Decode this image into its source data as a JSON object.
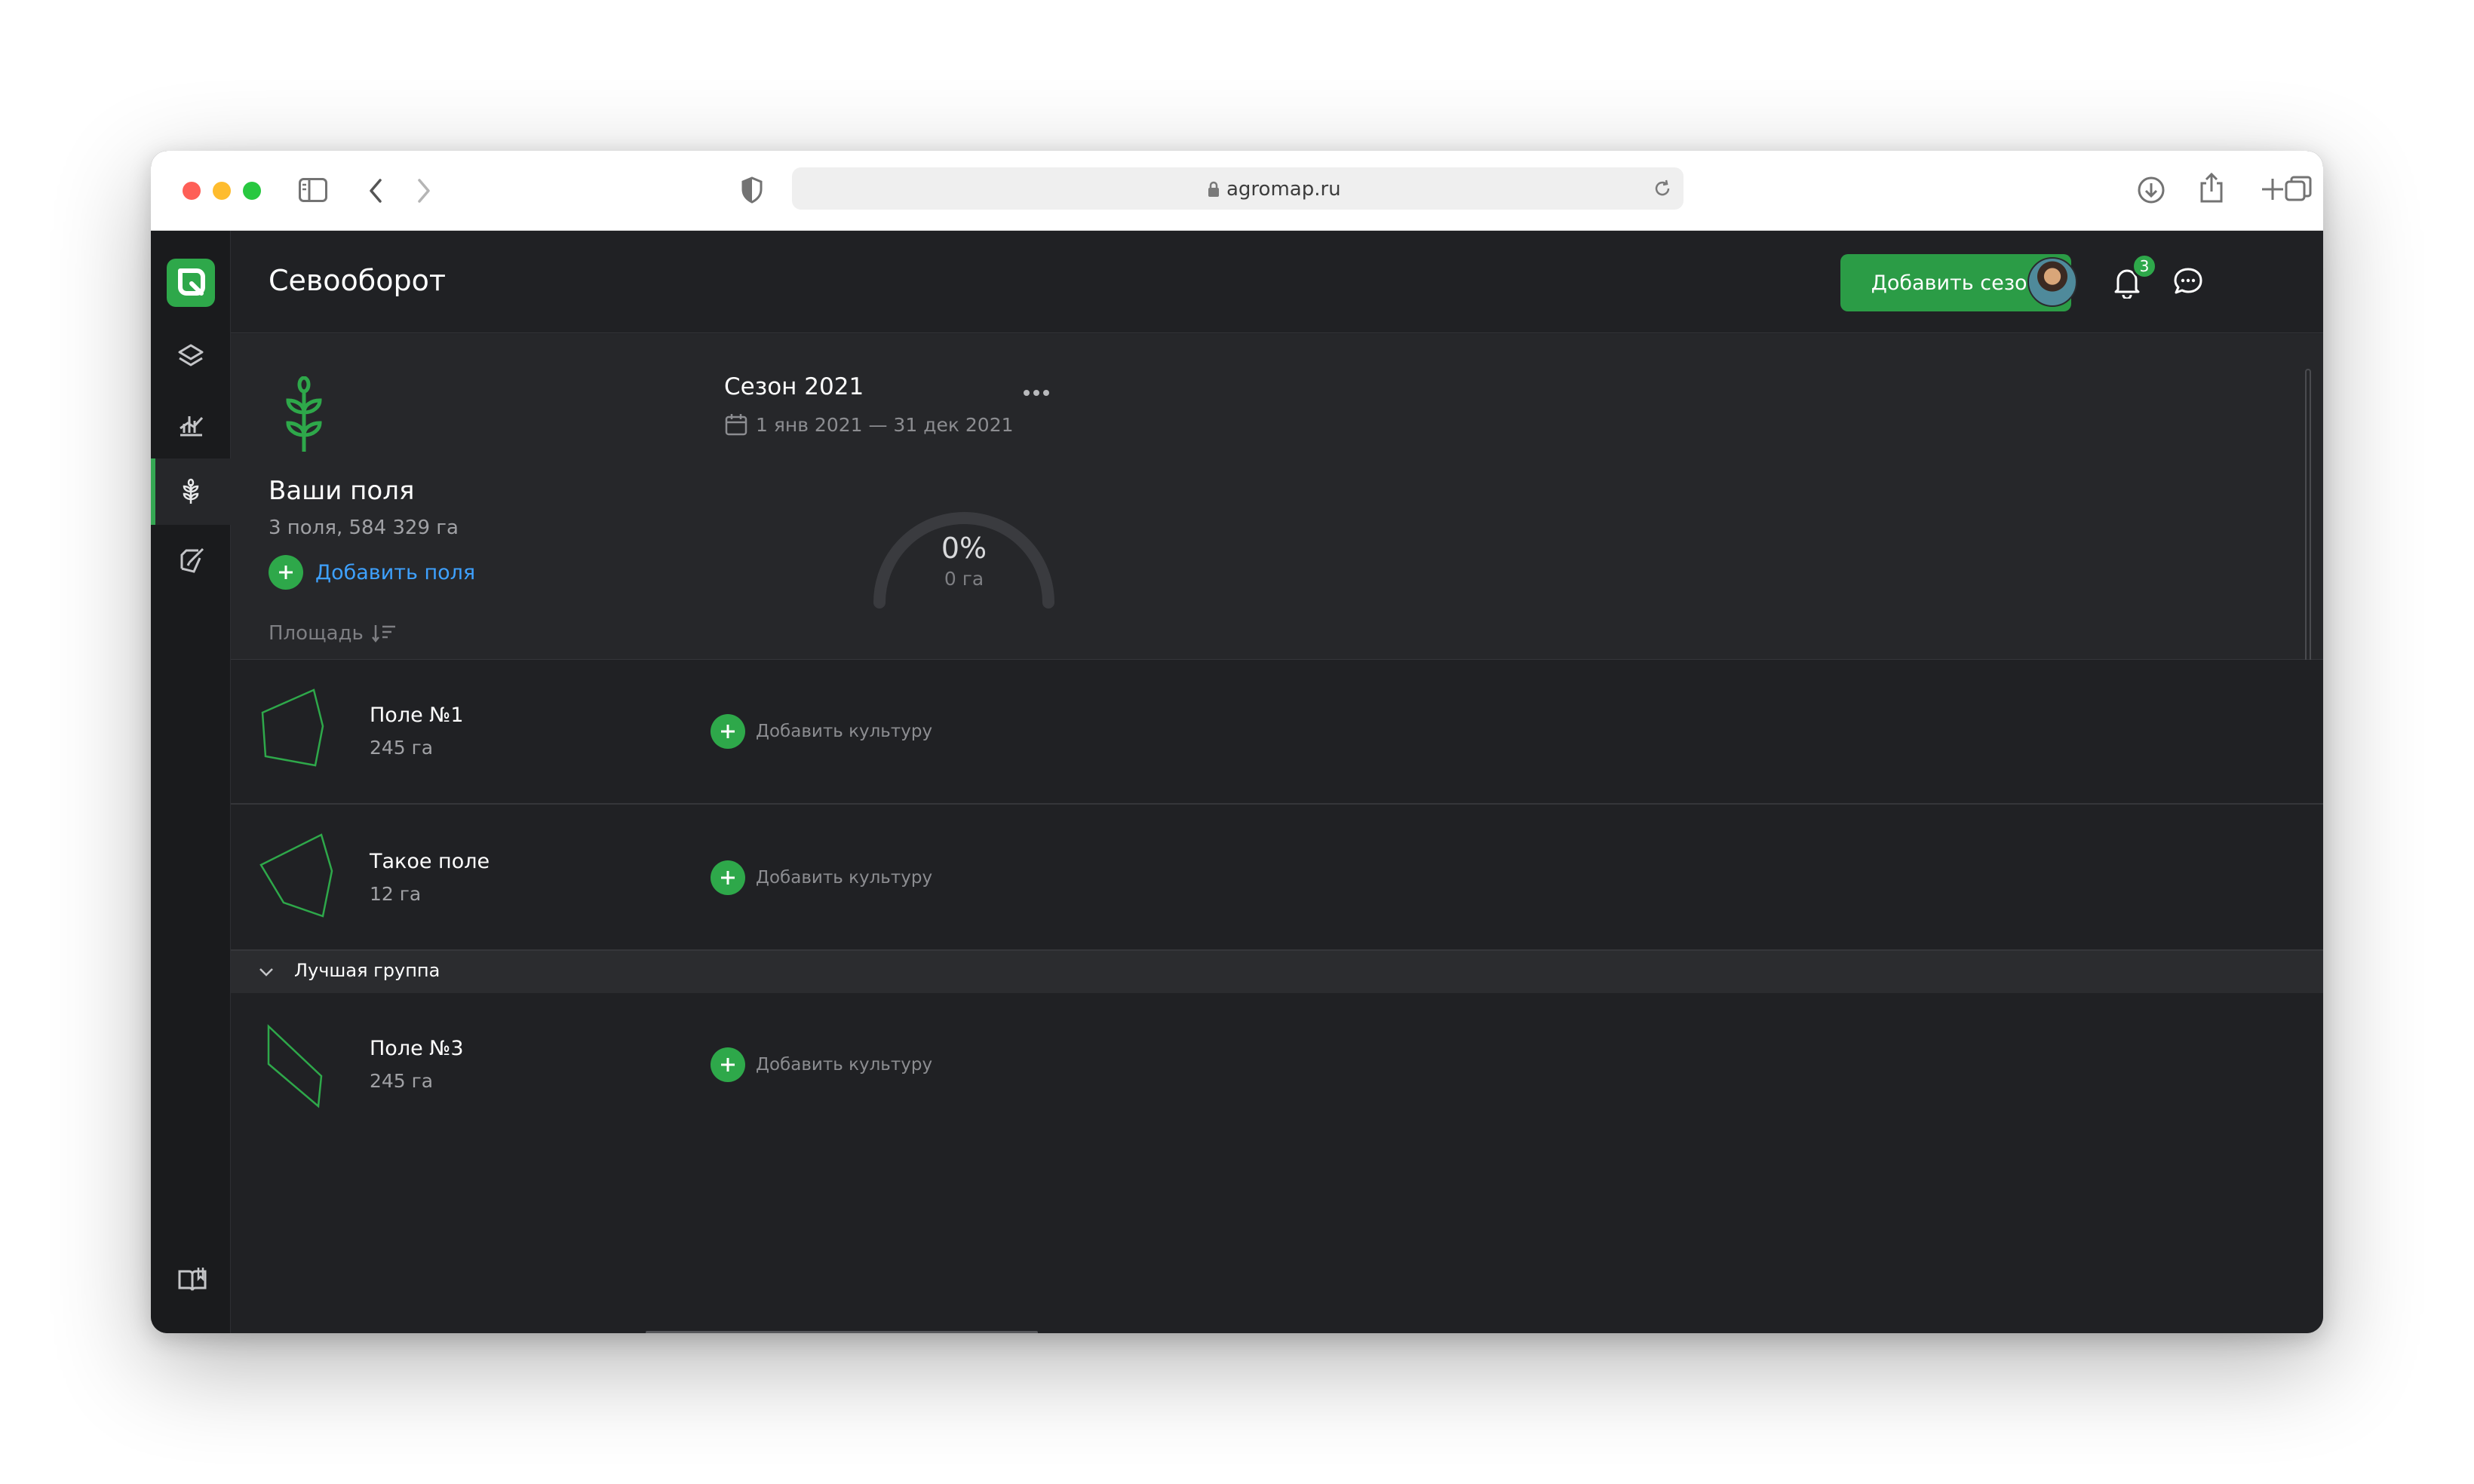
{
  "browser": {
    "url": "agromap.ru"
  },
  "header": {
    "title": "Севооборот",
    "add_season_label": "Добавить сезон",
    "notifications_count": "3"
  },
  "sidebar": {
    "items": [
      {
        "name": "layers-icon"
      },
      {
        "name": "analytics-icon"
      },
      {
        "name": "crop-rotation-icon",
        "active": true
      },
      {
        "name": "notes-icon"
      },
      {
        "name": "book-icon"
      }
    ]
  },
  "summary": {
    "title": "Ваши поля",
    "subtitle": "3 поля, 584 329 га",
    "add_fields_label": "Добавить поля",
    "sort_label": "Площадь"
  },
  "season": {
    "title": "Сезон 2021",
    "dates": "1 янв 2021 — 31 дек 2021",
    "progress_pct_label": "0%",
    "progress_area_label": "0 га",
    "progress": 0
  },
  "fields": [
    {
      "name": "Поле №1",
      "area": "245 га",
      "add_culture_label": "Добавить культуру"
    },
    {
      "name": "Такое поле",
      "area": "12 га",
      "add_culture_label": "Добавить культуру"
    }
  ],
  "group": {
    "name": "Лучшая группа",
    "fields": [
      {
        "name": "Поле №3",
        "area": "245 га",
        "add_culture_label": "Добавить культуру"
      }
    ]
  },
  "colors": {
    "accent": "#2ea84a",
    "link": "#3ea1ff",
    "background": "#202124"
  }
}
